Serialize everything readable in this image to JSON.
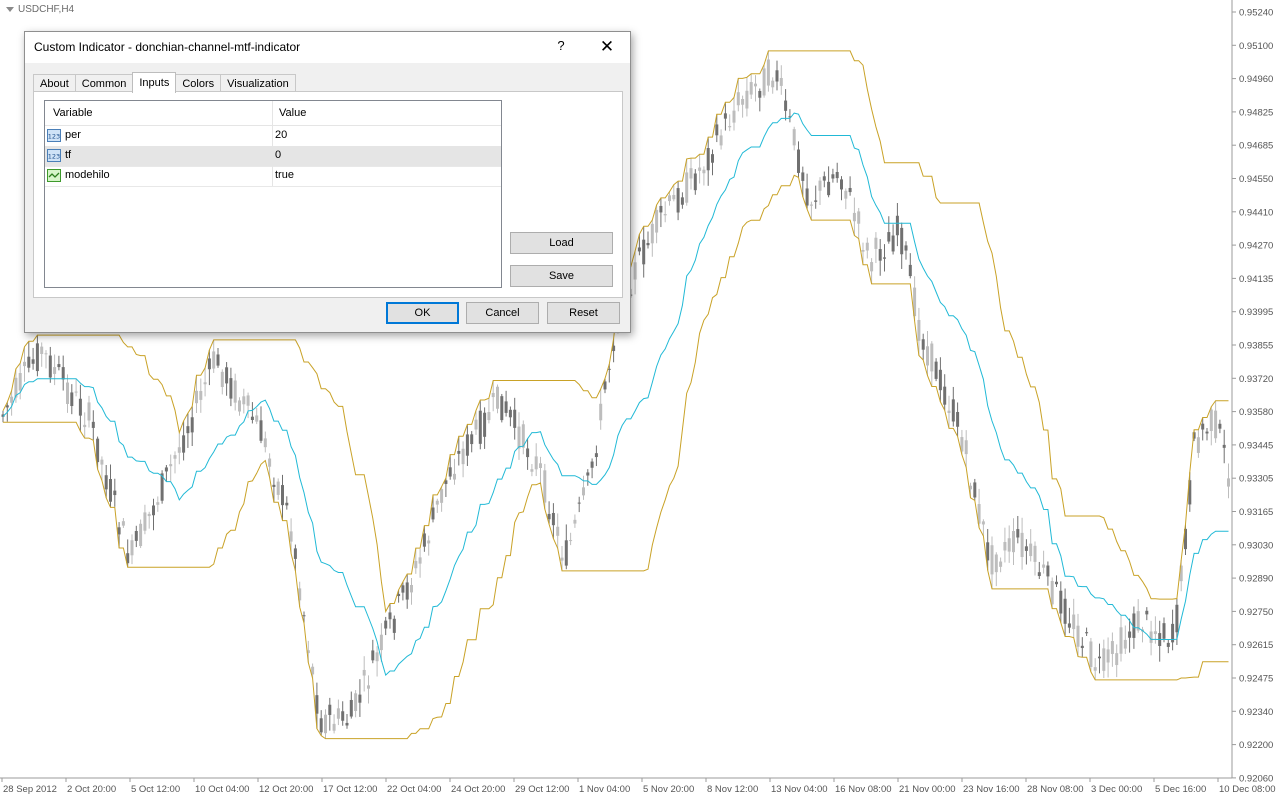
{
  "chart": {
    "symbol": "USDCHF,H4",
    "price_labels": [
      "0.95240",
      "0.95100",
      "0.94960",
      "0.94825",
      "0.94685",
      "0.94550",
      "0.94410",
      "0.94270",
      "0.94135",
      "0.93995",
      "0.93855",
      "0.93720",
      "0.93580",
      "0.93445",
      "0.93305",
      "0.93165",
      "0.93030",
      "0.92890",
      "0.92750",
      "0.92615",
      "0.92475",
      "0.92340",
      "0.92200",
      "0.92060"
    ],
    "time_labels": [
      "28 Sep 2012",
      "2 Oct 20:00",
      "5 Oct 12:00",
      "10 Oct 04:00",
      "12 Oct 20:00",
      "17 Oct 12:00",
      "22 Oct 04:00",
      "24 Oct 20:00",
      "29 Oct 12:00",
      "1 Nov 04:00",
      "5 Nov 20:00",
      "8 Nov 12:00",
      "13 Nov 04:00",
      "16 Nov 08:00",
      "21 Nov 00:00",
      "23 Nov 16:00",
      "28 Nov 08:00",
      "3 Dec 00:00",
      "5 Dec 16:00",
      "10 Dec 08:00"
    ],
    "colors": {
      "channel": "#c9a227",
      "midline": "#21b9d6",
      "candle_dark": "#707070",
      "candle_light": "#bdbdbd",
      "axis": "#9b9b9b"
    }
  },
  "dialog": {
    "title": "Custom Indicator - donchian-channel-mtf-indicator",
    "help": "?",
    "close": "✕",
    "tabs": [
      "About",
      "Common",
      "Inputs",
      "Colors",
      "Visualization"
    ],
    "active_tab": "Inputs",
    "grid": {
      "col_variable": "Variable",
      "col_value": "Value",
      "rows": [
        {
          "variable": "per",
          "value": "20",
          "icon": "number-icon"
        },
        {
          "variable": "tf",
          "value": "0",
          "icon": "number-icon"
        },
        {
          "variable": "modehilo",
          "value": "true",
          "icon": "bool-icon"
        }
      ]
    },
    "buttons": {
      "load": "Load",
      "save": "Save",
      "ok": "OK",
      "cancel": "Cancel",
      "reset": "Reset"
    }
  }
}
